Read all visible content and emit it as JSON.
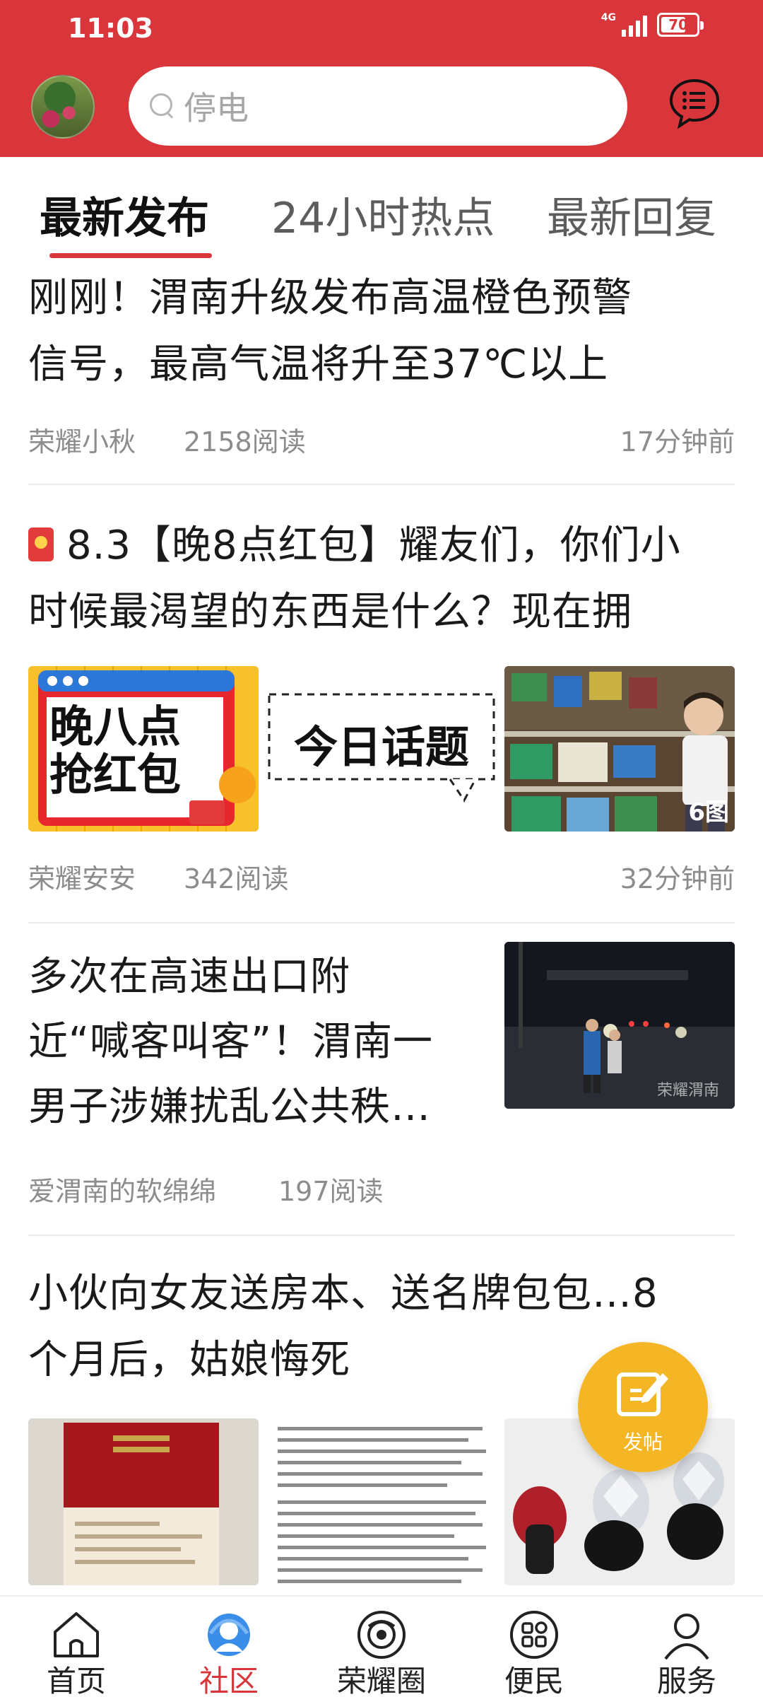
{
  "status_bar": {
    "time": "11:03",
    "network": "4G",
    "battery": "70",
    "battery_level": 0.7
  },
  "header": {
    "search_placeholder": "停电"
  },
  "tabs": [
    {
      "label": "最新发布",
      "active": true
    },
    {
      "label": "24小时热点",
      "active": false
    },
    {
      "label": "最新回复",
      "active": false
    }
  ],
  "feed": [
    {
      "title_line1": "刚刚！渭南升级发布高温橙色预警",
      "title_line2": "信号，最高气温将升至37℃以上",
      "author": "荣耀小秋",
      "reads": "2158阅读",
      "time": "17分钟前"
    },
    {
      "title_line1": "8.3【晚8点红包】耀友们，你们小",
      "title_line2": "时候最渴望的东西是什么？现在拥",
      "thumb1_text_a": "晚八点",
      "thumb1_text_b": "抢红包",
      "thumb2_text": "今日话题",
      "image_count": "6图",
      "author": "荣耀安安",
      "reads": "342阅读",
      "time": "32分钟前"
    },
    {
      "title_line1": "多次在高速出口附",
      "title_line2": "近“喊客叫客”！渭南一",
      "title_line3": "男子涉嫌扰乱公共秩…",
      "watermark": "荣耀渭南",
      "author": "爱渭南的软绵绵",
      "reads": "197阅读"
    },
    {
      "title_line1": "小伙向女友送房本、送名牌包包…8",
      "title_line2": "个月后，姑娘悔死"
    }
  ],
  "fab": {
    "label": "发帖"
  },
  "bottom_nav": [
    {
      "label": "首页",
      "icon": "home-icon",
      "active": false
    },
    {
      "label": "社区",
      "icon": "community-icon",
      "active": true
    },
    {
      "label": "荣耀圈",
      "icon": "circle-icon",
      "active": false
    },
    {
      "label": "便民",
      "icon": "grid-icon",
      "active": false
    },
    {
      "label": "服务",
      "icon": "person-icon",
      "active": false
    }
  ],
  "colors": {
    "brand_red": "#d9363b",
    "fab_yellow": "#f5b625",
    "meta_gray": "#8c8c8c"
  }
}
